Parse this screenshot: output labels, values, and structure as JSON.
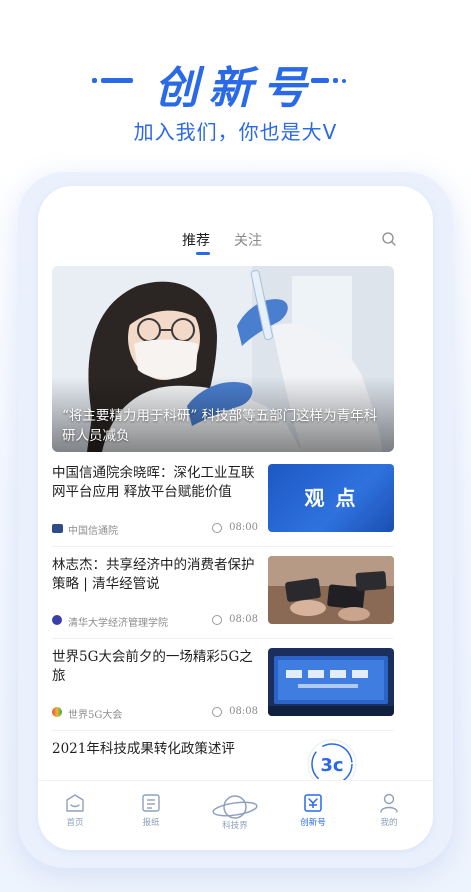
{
  "promo": {
    "title": "创新号",
    "subtitle": "加入我们，你也是大V"
  },
  "tabs": [
    {
      "label": "推荐",
      "active": true
    },
    {
      "label": "关注",
      "active": false
    }
  ],
  "banner": {
    "caption": "“将主要精力用于科研” 科技部等五部门这样为青年科研人员减负"
  },
  "news": [
    {
      "title": "中国信通院余晓晖：深化工业互联网平台应用 释放平台赋能价值",
      "source": "中国信通院",
      "time": "08:00",
      "thumb_text": "观 点"
    },
    {
      "title": "林志杰：共享经济中的消费者保护策略 | 清华经管说",
      "source": "清华大学经济管理学院",
      "time": "08:08"
    },
    {
      "title": "世界5G大会前夕的一场精彩5G之旅",
      "source": "世界5G大会",
      "time": "08:08"
    },
    {
      "title": "2021年科技成果转化政策述评"
    }
  ],
  "float_badge": "3c",
  "nav": [
    {
      "label": "首页",
      "icon": "home-icon"
    },
    {
      "label": "报纸",
      "icon": "newspaper-icon"
    },
    {
      "label": "科技界",
      "icon": "planet-icon"
    },
    {
      "label": "创新号",
      "icon": "innovation-icon",
      "active": true
    },
    {
      "label": "我的",
      "icon": "profile-icon"
    }
  ],
  "colors": {
    "accent": "#2a6ae8",
    "nav_inactive": "#8ea0bc",
    "thumb_blue": "#1f5fc9"
  }
}
